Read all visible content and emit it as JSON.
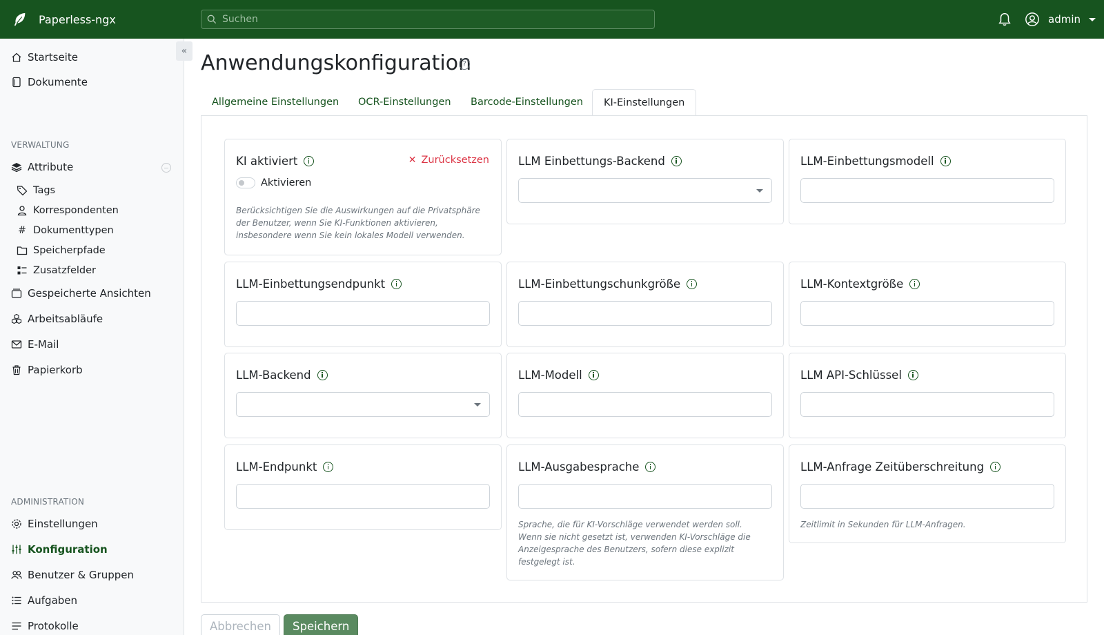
{
  "app": {
    "name": "Paperless-ngx"
  },
  "search": {
    "placeholder": "Suchen"
  },
  "user": {
    "name": "admin"
  },
  "sidebar": {
    "main": [
      {
        "label": "Startseite"
      },
      {
        "label": "Dokumente"
      }
    ],
    "section_manage": "VERWALTUNG",
    "manage": [
      {
        "label": "Attribute"
      },
      {
        "label": "Tags"
      },
      {
        "label": "Korrespondenten"
      },
      {
        "label": "Dokumenttypen"
      },
      {
        "label": "Speicherpfade"
      },
      {
        "label": "Zusatzfelder"
      },
      {
        "label": "Gespeicherte Ansichten"
      },
      {
        "label": "Arbeitsabläufe"
      },
      {
        "label": "E-Mail"
      },
      {
        "label": "Papierkorb"
      }
    ],
    "section_admin": "ADMINISTRATION",
    "admin": [
      {
        "label": "Einstellungen"
      },
      {
        "label": "Konfiguration"
      },
      {
        "label": "Benutzer & Gruppen"
      },
      {
        "label": "Aufgaben"
      },
      {
        "label": "Protokolle"
      }
    ]
  },
  "page": {
    "title": "Anwendungskonfiguration",
    "help_glyph": "?",
    "tabs": [
      {
        "label": "Allgemeine Einstellungen"
      },
      {
        "label": "OCR-Einstellungen"
      },
      {
        "label": "Barcode-Einstellungen"
      },
      {
        "label": "KI-Einstellungen"
      }
    ],
    "active_tab": "KI-Einstellungen"
  },
  "settings": {
    "ai_enabled": {
      "label": "KI aktiviert",
      "reset": "Zurücksetzen",
      "toggle_label": "Aktivieren",
      "hint": "Berücksichtigen Sie die Auswirkungen auf die Privatsphäre der Benutzer, wenn Sie KI-Funktionen aktivieren, insbesondere wenn Sie kein lokales Modell verwenden."
    },
    "embedding_backend": {
      "label": "LLM Einbettungs-Backend",
      "value": ""
    },
    "embedding_model": {
      "label": "LLM-Einbettungsmodell",
      "value": ""
    },
    "embedding_endpoint": {
      "label": "LLM-Einbettungsendpunkt",
      "value": ""
    },
    "embedding_chunk_size": {
      "label": "LLM-Einbettungschunkgröße",
      "value": ""
    },
    "context_size": {
      "label": "LLM-Kontextgröße",
      "value": ""
    },
    "backend": {
      "label": "LLM-Backend",
      "value": ""
    },
    "model": {
      "label": "LLM-Modell",
      "value": ""
    },
    "api_key": {
      "label": "LLM API-Schlüssel",
      "value": ""
    },
    "endpoint": {
      "label": "LLM-Endpunkt",
      "value": ""
    },
    "output_language": {
      "label": "LLM-Ausgabesprache",
      "value": "",
      "hint": "Sprache, die für KI-Vorschläge verwendet werden soll. Wenn sie nicht gesetzt ist, verwenden KI-Vorschläge die Anzeigesprache des Benutzers, sofern diese explizit festgelegt ist."
    },
    "request_timeout": {
      "label": "LLM-Anfrage Zeitüberschreitung",
      "value": "",
      "hint": "Zeitlimit in Sekunden für LLM-Anfragen."
    }
  },
  "actions": {
    "cancel": "Abbrechen",
    "save": "Speichern"
  },
  "colors": {
    "primary": "#17541f",
    "danger": "#dc3545"
  }
}
